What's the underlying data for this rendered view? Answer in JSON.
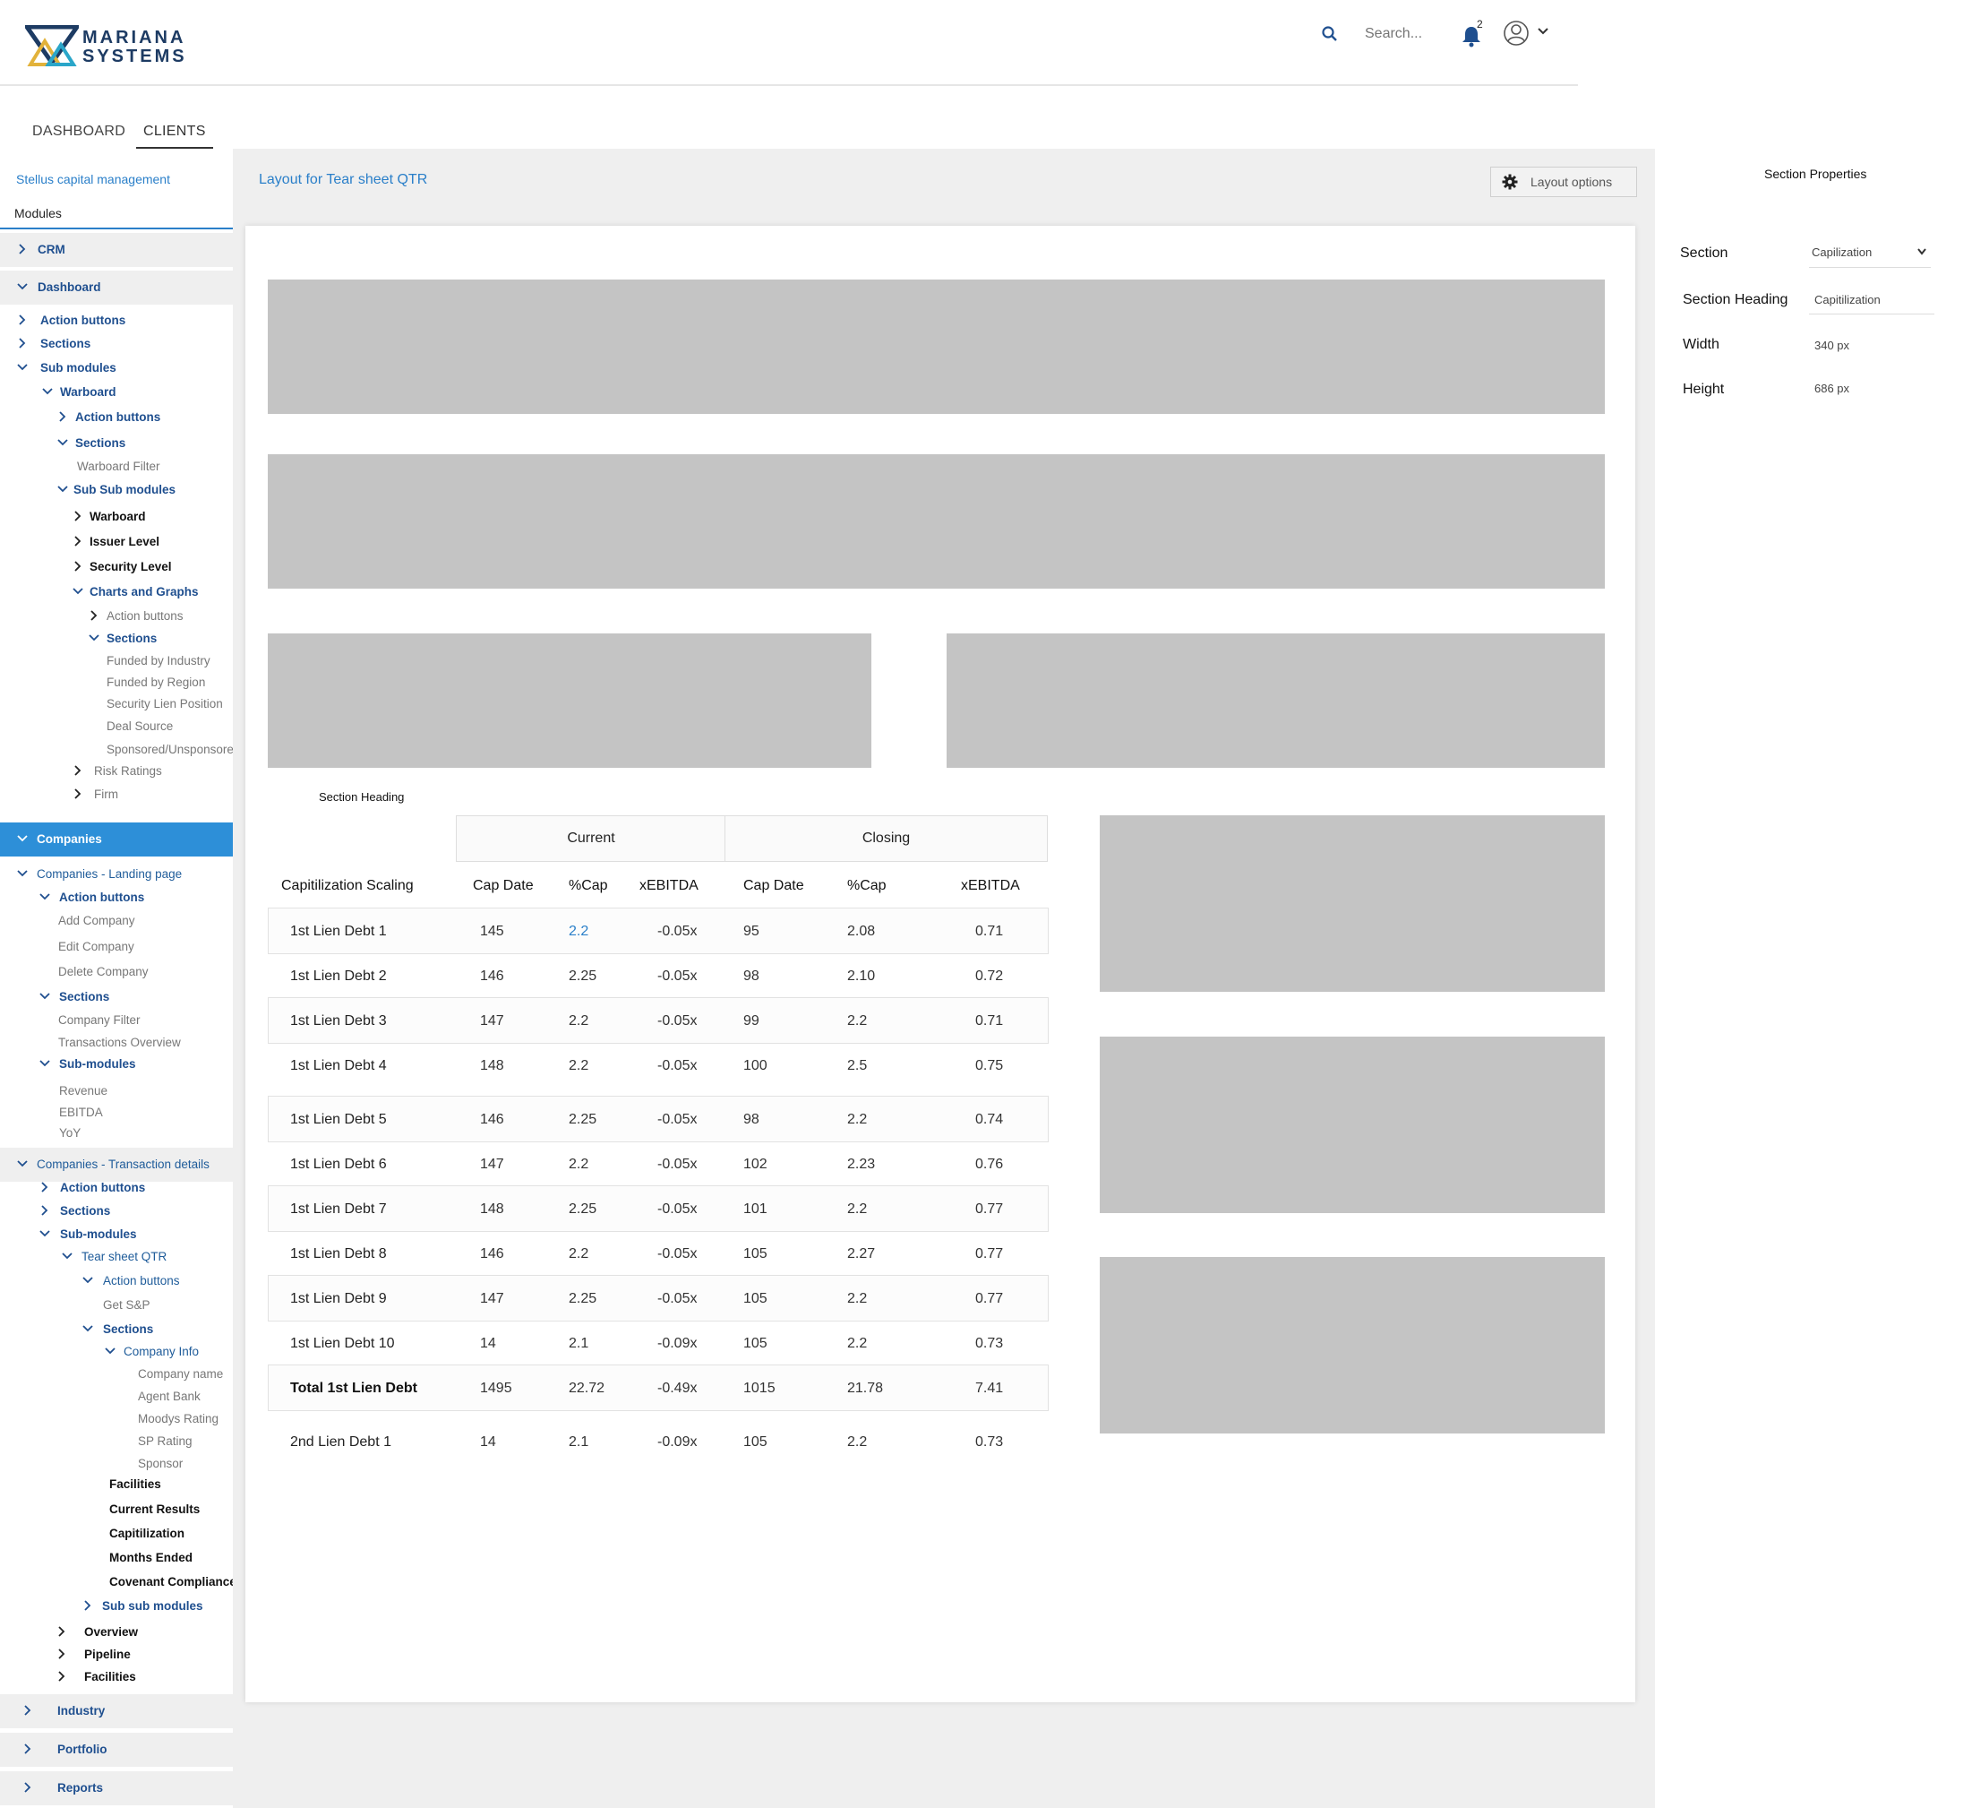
{
  "brand": {
    "line1": "MARIANA",
    "line2": "SYSTEMS"
  },
  "header": {
    "search_placeholder": "Search...",
    "notifications_count": "2"
  },
  "nav": {
    "tabs": [
      "DASHBOARD",
      "CLIENTS"
    ],
    "active": "CLIENTS"
  },
  "sidebar": {
    "client": "Stellus capital management",
    "modules_title": "Modules",
    "items": {
      "crm": "CRM",
      "dashboard": "Dashboard",
      "d_action": "Action buttons",
      "d_sections": "Sections",
      "d_sub": "Sub modules",
      "warboard": "Warboard",
      "w_action": "Action buttons",
      "w_sections": "Sections",
      "warboard_filter": "Warboard Filter",
      "sub_sub": "Sub Sub modules",
      "ss_warboard": "Warboard",
      "ss_issuer": "Issuer Level",
      "ss_security": "Security Level",
      "ss_charts": "Charts and Graphs",
      "cg_action": "Action buttons",
      "cg_sections": "Sections",
      "cg_industry": "Funded by Industry",
      "cg_region": "Funded by Region",
      "cg_lien": "Security Lien Position",
      "cg_deal": "Deal Source",
      "cg_sponsored": "Sponsored/Unsponsored",
      "risk": "Risk Ratings",
      "firm": "Firm",
      "companies": "Companies",
      "landing": "Companies - Landing page",
      "l_action": "Action buttons",
      "add_company": "Add Company",
      "edit_company": "Edit Company",
      "delete_company": "Delete Company",
      "l_sections": "Sections",
      "company_filter": "Company Filter",
      "transactions_overview": "Transactions Overview",
      "l_sub": "Sub-modules",
      "revenue": "Revenue",
      "ebitda": "EBITDA",
      "yoy": "YoY",
      "transaction": "Companies - Transaction details",
      "t_action": "Action buttons",
      "t_sections": "Sections",
      "t_sub": "Sub-modules",
      "tear": "Tear sheet QTR",
      "tear_action": "Action buttons",
      "get_sp": "Get S&P",
      "tear_sections": "Sections",
      "company_info": "Company Info",
      "company_name": "Company name",
      "agent_bank": "Agent Bank",
      "moodys": "Moodys Rating",
      "sp_rating": "SP Rating",
      "sponsor": "Sponsor",
      "facilities": "Facilities",
      "current_results": "Current Results",
      "capitilization": "Capitilization",
      "months_ended": "Months Ended",
      "covenant": "Covenant Compliance",
      "sub_sub_modules": "Sub sub modules",
      "overview": "Overview",
      "pipeline": "Pipeline",
      "t_facilities": "Facilities",
      "industry": "Industry",
      "portfolio": "Portfolio",
      "reports": "Reports"
    }
  },
  "main": {
    "title": "Layout for Tear sheet QTR",
    "layout_options": "Layout options",
    "section_heading": "Section Heading",
    "group_current": "Current",
    "group_closing": "Closing",
    "columns": [
      "Capitilization Scaling",
      "Cap Date",
      "%Cap",
      "xEBITDA",
      "Cap Date",
      "%Cap",
      "xEBITDA"
    ],
    "rows": [
      [
        "1st Lien Debt 1",
        "145",
        "2.2",
        "-0.05x",
        "95",
        "2.08",
        "0.71"
      ],
      [
        "1st Lien Debt 2",
        "146",
        "2.25",
        "-0.05x",
        "98",
        "2.10",
        "0.72"
      ],
      [
        "1st Lien Debt 3",
        "147",
        "2.2",
        "-0.05x",
        "99",
        "2.2",
        "0.71"
      ],
      [
        "1st Lien Debt 4",
        "148",
        "2.2",
        "-0.05x",
        "100",
        "2.5",
        "0.75"
      ],
      [
        "1st Lien Debt 5",
        "146",
        "2.25",
        "-0.05x",
        "98",
        "2.2",
        "0.74"
      ],
      [
        "1st Lien Debt 6",
        "147",
        "2.2",
        "-0.05x",
        "102",
        "2.23",
        "0.76"
      ],
      [
        "1st Lien Debt 7",
        "148",
        "2.25",
        "-0.05x",
        "101",
        "2.2",
        "0.77"
      ],
      [
        "1st Lien Debt 8",
        "146",
        "2.2",
        "-0.05x",
        "105",
        "2.27",
        "0.77"
      ],
      [
        "1st Lien Debt 9",
        "147",
        "2.25",
        "-0.05x",
        "105",
        "2.2",
        "0.77"
      ],
      [
        "1st Lien Debt 10",
        "14",
        "2.1",
        "-0.09x",
        "105",
        "2.2",
        "0.73"
      ],
      [
        "Total 1st Lien Debt",
        "1495",
        "22.72",
        "-0.49x",
        "1015",
        "21.78",
        "7.41"
      ],
      [
        "2nd Lien Debt 1",
        "14",
        "2.1",
        "-0.09x",
        "105",
        "2.2",
        "0.73"
      ]
    ]
  },
  "properties": {
    "title": "Section Properties",
    "section_label": "Section",
    "section_value": "Capilization",
    "heading_label": "Section Heading",
    "heading_value": "Capitilization",
    "width_label": "Width",
    "width_value": "340 px",
    "height_label": "Height",
    "height_value": "686 px"
  },
  "colors": {
    "accent": "#2d8fd8",
    "link": "#2a7fc9",
    "navy": "#1f4f8f",
    "placeholder": "#c4c4c4"
  }
}
